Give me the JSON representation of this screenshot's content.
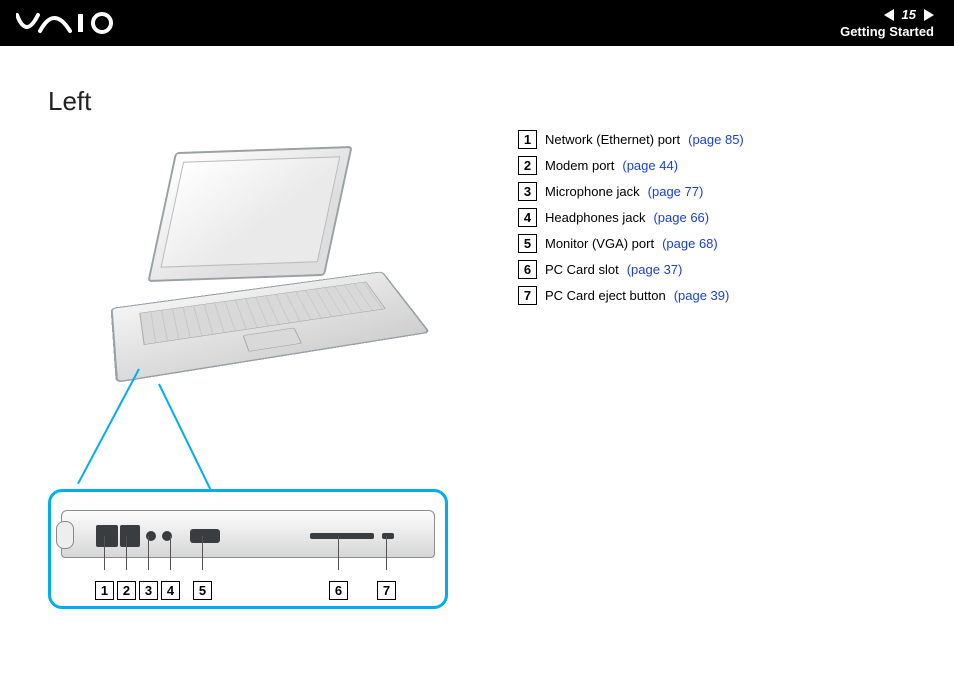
{
  "header": {
    "brand": "VAIO",
    "page_number": "15",
    "section": "Getting Started"
  },
  "title": "Left",
  "diagram_labels": [
    "1",
    "2",
    "3",
    "4",
    "5",
    "6",
    "7"
  ],
  "items": [
    {
      "num": "1",
      "label": "Network (Ethernet) port ",
      "link": "(page 85)"
    },
    {
      "num": "2",
      "label": "Modem port ",
      "link": "(page 44)"
    },
    {
      "num": "3",
      "label": "Microphone jack ",
      "link": "(page 77)"
    },
    {
      "num": "4",
      "label": "Headphones jack ",
      "link": "(page 66)"
    },
    {
      "num": "5",
      "label": "Monitor (VGA) port ",
      "link": "(page 68)"
    },
    {
      "num": "6",
      "label": "PC Card slot ",
      "link": "(page 37)"
    },
    {
      "num": "7",
      "label": "PC Card eject button ",
      "link": "(page 39)"
    }
  ]
}
